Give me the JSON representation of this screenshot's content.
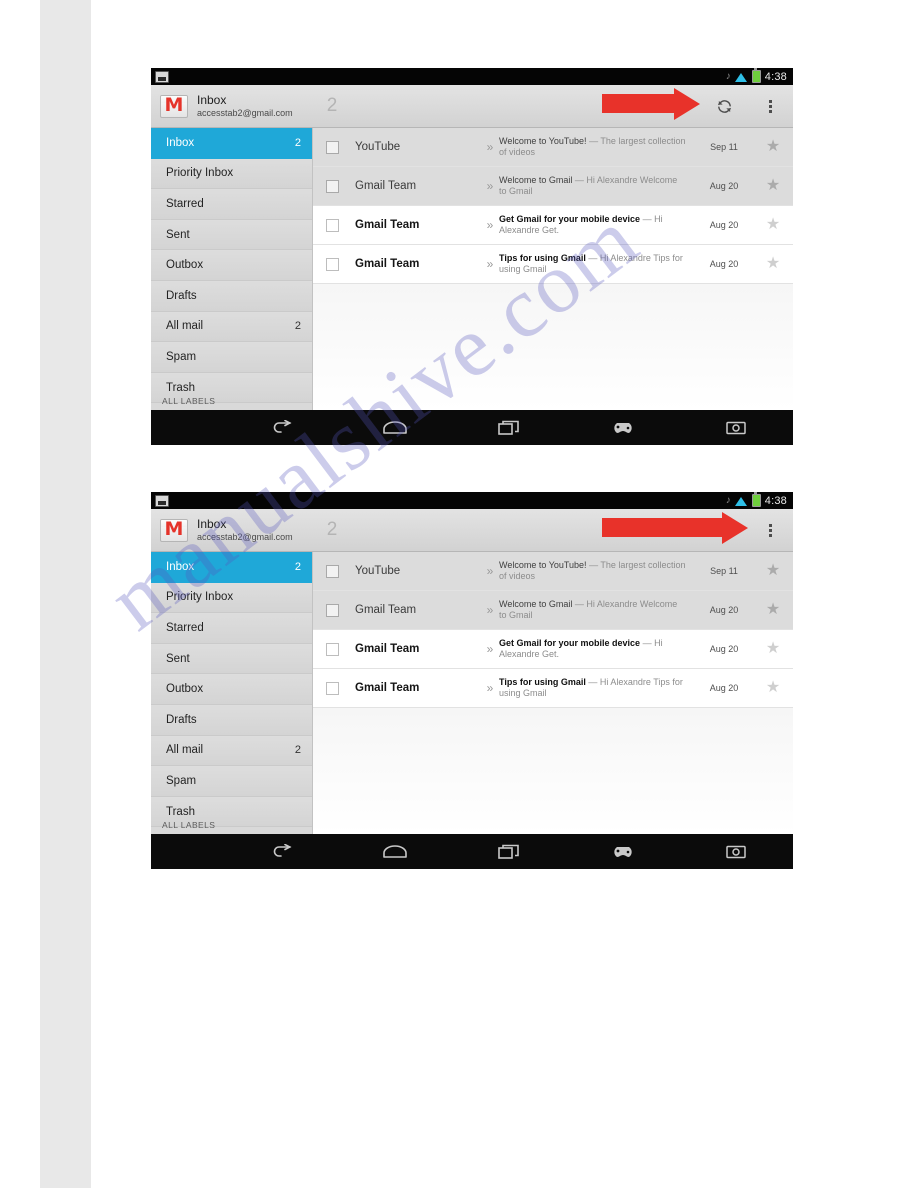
{
  "page": {
    "watermark": "manualshive.com"
  },
  "screenshots": [
    {
      "id": "screenshot-1",
      "annotation_target": "refresh-button",
      "show_refresh": true
    },
    {
      "id": "screenshot-2",
      "annotation_target": "overflow-menu-button",
      "show_refresh": false
    }
  ],
  "statusbar": {
    "time": "4:38",
    "icons": {
      "notification": "notification-icon",
      "mute": "vibrate-icon",
      "wifi": "wifi-icon",
      "battery": "battery-icon"
    }
  },
  "actionbar": {
    "app_icon": "gmail-logo-icon",
    "logo_letter": "M",
    "title": "Inbox",
    "subtitle": "accesstab2@gmail.com",
    "count": "2",
    "refresh_icon": "refresh-icon",
    "overflow_icon": "overflow-menu-icon"
  },
  "sidebar": {
    "items": [
      {
        "label": "Inbox",
        "count": "2",
        "selected": true
      },
      {
        "label": "Priority Inbox",
        "count": "",
        "selected": false
      },
      {
        "label": "Starred",
        "count": "",
        "selected": false
      },
      {
        "label": "Sent",
        "count": "",
        "selected": false
      },
      {
        "label": "Outbox",
        "count": "",
        "selected": false
      },
      {
        "label": "Drafts",
        "count": "",
        "selected": false
      },
      {
        "label": "All mail",
        "count": "2",
        "selected": false
      },
      {
        "label": "Spam",
        "count": "",
        "selected": false
      },
      {
        "label": "Trash",
        "count": "",
        "selected": false
      }
    ],
    "footer": "ALL LABELS"
  },
  "maillist": {
    "rows": [
      {
        "sender": "YouTube",
        "subject": "Welcome to YouTube!",
        "snippet": "— The largest collection of videos",
        "date": "Sep 11",
        "unread": false,
        "starred": false
      },
      {
        "sender": "Gmail Team",
        "subject": "Welcome to Gmail",
        "snippet": "— Hi Alexandre Welcome to Gmail",
        "date": "Aug 20",
        "unread": false,
        "starred": false
      },
      {
        "sender": "Gmail Team",
        "subject": "Get Gmail for your mobile device",
        "snippet": "— Hi Alexandre Get.",
        "date": "Aug 20",
        "unread": true,
        "starred": false
      },
      {
        "sender": "Gmail Team",
        "subject": "Tips for using Gmail",
        "snippet": "— Hi Alexandre Tips for using Gmail",
        "date": "Aug 20",
        "unread": true,
        "starred": false
      }
    ],
    "chevrons": "»",
    "star_glyph": "★"
  },
  "navbar": {
    "buttons": [
      {
        "name": "back-icon"
      },
      {
        "name": "home-icon"
      },
      {
        "name": "recents-icon"
      },
      {
        "name": "gamepad-icon"
      },
      {
        "name": "screenshot-icon"
      }
    ]
  }
}
